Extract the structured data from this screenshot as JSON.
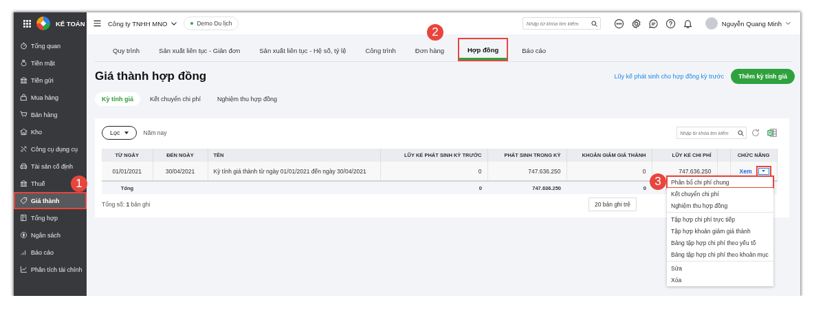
{
  "app": {
    "logo_text": "KẾ TOÁN"
  },
  "sidebar": {
    "items": [
      {
        "label": "Tổng quan",
        "selected": false,
        "highlighted": false
      },
      {
        "label": "Tiền mặt",
        "selected": false,
        "highlighted": false
      },
      {
        "label": "Tiền gửi",
        "selected": false,
        "highlighted": false
      },
      {
        "label": "Mua hàng",
        "selected": false,
        "highlighted": false
      },
      {
        "label": "Bán hàng",
        "selected": false,
        "highlighted": false
      },
      {
        "label": "Kho",
        "selected": false,
        "highlighted": false
      },
      {
        "label": "Công cụ dụng cụ",
        "selected": false,
        "highlighted": false
      },
      {
        "label": "Tài sản cố định",
        "selected": false,
        "highlighted": false
      },
      {
        "label": "Thuế",
        "selected": false,
        "highlighted": false
      },
      {
        "label": "Giá thành",
        "selected": true,
        "highlighted": true
      },
      {
        "label": "Tổng hợp",
        "selected": false,
        "highlighted": false
      },
      {
        "label": "Ngân sách",
        "selected": false,
        "highlighted": false
      },
      {
        "label": "Báo cáo",
        "selected": false,
        "highlighted": false
      },
      {
        "label": "Phân tích tài chính",
        "selected": false,
        "highlighted": false
      }
    ]
  },
  "topbar": {
    "company": "Công ty TNHH MNO",
    "database": "Demo Du lịch",
    "search": {
      "placeholder": "Nhập từ khóa tìm kiếm"
    },
    "user": "Nguyễn Quang Minh"
  },
  "tabs": [
    {
      "label": "Quy trình",
      "selected": false,
      "highlighted": false
    },
    {
      "label": "Sản xuất liên tục - Giản đơn",
      "selected": false,
      "highlighted": false
    },
    {
      "label": "Sản xuất liên tục - Hệ số, tỷ lệ",
      "selected": false,
      "highlighted": false
    },
    {
      "label": "Công trình",
      "selected": false,
      "highlighted": false
    },
    {
      "label": "Đơn hàng",
      "selected": false,
      "highlighted": false
    },
    {
      "label": "Hợp đồng",
      "selected": true,
      "highlighted": true
    },
    {
      "label": "Báo cáo",
      "selected": false,
      "highlighted": false
    }
  ],
  "page": {
    "title": "Giá thành hợp đồng",
    "link": "Lũy kế phát sinh cho hợp đồng kỳ trước",
    "primary_button": "Thêm kỳ tính giá"
  },
  "subtabs": [
    {
      "label": "Kỳ tính giá",
      "selected": true
    },
    {
      "label": "Kết chuyển chi phí",
      "selected": false
    },
    {
      "label": "Nghiệm thu hợp đồng",
      "selected": false
    }
  ],
  "filter": {
    "button": "Lọc",
    "period": "Năm nay"
  },
  "table_search": {
    "placeholder": "Nhập từ khóa tìm kiếm"
  },
  "table": {
    "columns": [
      "TỪ NGÀY",
      "ĐẾN NGÀY",
      "TÊN",
      "LŨY KẾ PHÁT SINH KỲ TRƯỚC",
      "PHÁT SINH TRONG KỲ",
      "KHOẢN GIẢM GIÁ THÀNH",
      "LŨY KẾ CHI PHÍ",
      "CHỨC NĂNG"
    ],
    "rows": [
      {
        "cells": [
          "01/01/2021",
          "30/04/2021",
          "Kỳ tính giá thành từ ngày 01/01/2021 đến ngày 30/04/2021",
          "0",
          "747.636.250",
          "0",
          "747.636.250"
        ],
        "action": "Xem",
        "menu_button_highlighted": true
      }
    ],
    "total": {
      "label": "Tổng",
      "cells": [
        "0",
        "747.636.250",
        "0"
      ]
    }
  },
  "footer": {
    "count": "Tổng số: **1** bản ghi",
    "page_size": "20 bản ghi trê"
  },
  "menu": {
    "groups": [
      [
        {
          "label": "Phân bổ chi phí chung",
          "highlighted": true
        },
        {
          "label": "Kết chuyển chi phí",
          "highlighted": false
        },
        {
          "label": "Nghiệm thu hợp đồng",
          "highlighted": false
        }
      ],
      [
        {
          "label": "Tập hợp chi phí trực tiếp",
          "highlighted": false
        },
        {
          "label": "Tập hợp khoản giảm giá thành",
          "highlighted": false
        },
        {
          "label": "Bảng tập hợp chi phí theo yếu tố",
          "highlighted": false
        },
        {
          "label": "Bảng tập hợp chi phí theo khoản mục",
          "highlighted": false
        }
      ],
      [
        {
          "label": "Sửa",
          "highlighted": false
        },
        {
          "label": "Xóa",
          "highlighted": false
        }
      ]
    ]
  },
  "callouts": [
    {
      "label": "1"
    },
    {
      "label": "2"
    },
    {
      "label": "3"
    }
  ]
}
